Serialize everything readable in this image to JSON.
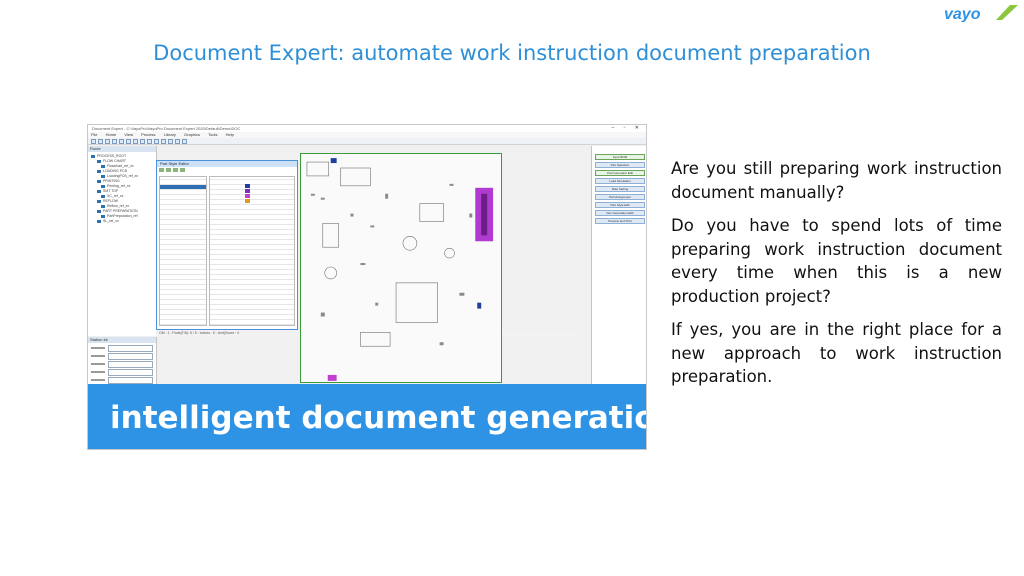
{
  "brand": {
    "logo_text": "vayo",
    "icon": "vayo-logo-icon",
    "colors": {
      "wordmark": "#2e93e4",
      "accent": "#8cc63f"
    }
  },
  "slide": {
    "title": "Document Expert: automate work instruction document preparation",
    "banner": "intelligent document generation",
    "paragraphs": [
      "Are you still preparing work instruction document manually?",
      "Do you have to spend lots of time preparing work instruction document every time when this is a new production project?",
      "If yes, you are in the right place for a new approach to work instruction preparation."
    ]
  },
  "colors": {
    "title": "#2f8fd6",
    "banner_bg": "#2e93e4",
    "banner_text": "#ffffff",
    "body_text": "#111111"
  },
  "screenshot": {
    "window_title": "Document Expert - C:\\VayoPro\\VayoPro Document Expert 2020\\Default\\Demo\\DOC",
    "menu": [
      "File",
      "Home",
      "View",
      "Process",
      "Library",
      "Graphics",
      "Tools",
      "Help"
    ],
    "tree_title": "Route",
    "tree_items": [
      "PROCESS_ROOT",
      "FLOW CHART",
      "Flowchart_ref_xx",
      "LOADING PCB",
      "LoadingPCB_ref_xx",
      "PRINTING",
      "Printing_ref_xx",
      "SMT TOP",
      "SC_ref_xx",
      "REFLOW",
      "Reflow_ref_xx",
      "PART PREPARATION",
      "PartPreparation_ref",
      "SL_ref_xx"
    ],
    "editor_title": "Part Style Editor",
    "status_text": "OM : 1 : Parts(T:B): 5 / 5 : Inches : 5 : Unit(Score : 0",
    "props_title": "Station kit",
    "steps": [
      {
        "label": "Input BOM",
        "checked": true
      },
      {
        "label": "Part Selection",
        "checked": false
      },
      {
        "label": "Part Generator Edit",
        "checked": true
      },
      {
        "label": "Load Simulation",
        "checked": false
      },
      {
        "label": "Rule Setting",
        "checked": false
      },
      {
        "label": "Part Assignment",
        "checked": false
      },
      {
        "label": "Part Style Edit",
        "checked": false
      },
      {
        "label": "Doc Generation Edit",
        "checked": false
      },
      {
        "label": "Preview and Print",
        "checked": false
      }
    ],
    "swatch_colors": [
      "#1f3fa0",
      "#7b2fbf",
      "#c13fd1",
      "#e09a1f"
    ]
  }
}
